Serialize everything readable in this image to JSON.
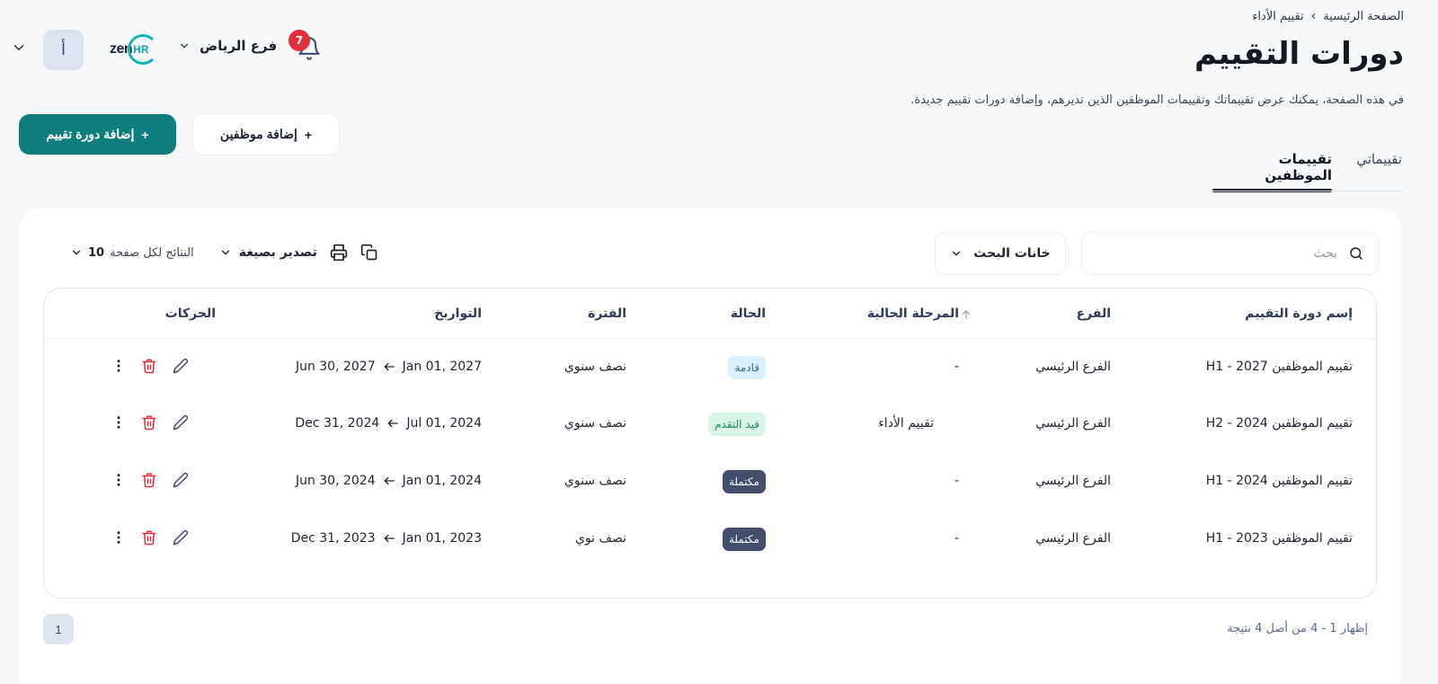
{
  "header": {
    "avatar_letter": "أ",
    "logo_text": "zen",
    "logo_accent": "HR",
    "branch": "فرع الرياض",
    "notifications_count": "7",
    "breadcrumb": {
      "home": "الصفحة الرئيسية",
      "separator": "›",
      "current": "تقييم الأداء"
    },
    "title": "دورات التقييم",
    "description": "في هذه الصفحة، يمكنك عرض تقييماتك وتقييمات الموظفين الذين تديرهم، وإضافة دورات تقييم جديدة.",
    "add_cycle_label": "إضافة دورة تقييم",
    "add_employee_label": "إضافة موظفين",
    "plus": "+"
  },
  "tabs": [
    {
      "label": "تقييماتي",
      "active": false
    },
    {
      "label": "تقييمات الموظفين",
      "active": true
    }
  ],
  "toolbar": {
    "search_placeholder": "بحث",
    "search_fields_label": "خانات البحث",
    "export_label": "تصدير بصيغة",
    "per_page_label": "النتائج لكل صفحة",
    "per_page_value": "10"
  },
  "table": {
    "columns": [
      "إسم دورة التقييم",
      "الفرع",
      "المرحلة الحالية",
      "الحالة",
      "الفترة",
      "التواريخ",
      "الحركات"
    ],
    "rows": [
      {
        "name": "تقييم الموظفين H1 - 2027",
        "branch": "الفرع الرئيسي",
        "stage": "-",
        "status": "قادمة",
        "period": "نصف سنوي",
        "start": "Jan 01, 2027",
        "end": "Jun 30, 2027"
      },
      {
        "name": "تقييم الموظفين H2 - 2024",
        "branch": "الفرع الرئيسي",
        "stage": "تقييم الأداء",
        "status": "قيد التقدم",
        "period": "نصف سنوي",
        "start": "Jul 01, 2024",
        "end": "Dec 31, 2024"
      },
      {
        "name": "تقييم الموظفين H1 - 2024",
        "branch": "الفرع الرئيسي",
        "stage": "-",
        "status": "مكتملة",
        "period": "نصف سنوي",
        "start": "Jan 01, 2024",
        "end": "Jun 30, 2024"
      },
      {
        "name": "تقييم الموظفين H1 - 2023",
        "branch": "الفرع الرئيسي",
        "stage": "-",
        "status": "مكتملة",
        "period": "نصف نوي",
        "start": "Jan 01, 2023",
        "end": "Dec 31, 2023"
      }
    ]
  },
  "footer": {
    "page": "1",
    "summary": "إظهار 1 - 4 من أصل 4 نتيجة"
  },
  "colors": {
    "primary": "#0d7d7d",
    "badge_upcoming": "#dcefff",
    "badge_progress": "#d8f5e8",
    "badge_done": "#444f6e",
    "danger": "#d4313c"
  },
  "icons": [
    "chevron-down-icon",
    "bell-icon",
    "search-icon",
    "copy-icon",
    "print-icon",
    "sort-arrow-icon",
    "arrow-left-icon",
    "kebab-icon",
    "trash-icon",
    "edit-icon"
  ]
}
